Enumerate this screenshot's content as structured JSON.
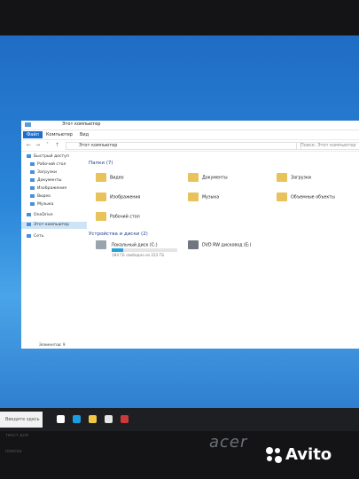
{
  "window": {
    "title": "Этот компьютер",
    "ribbon_tabs": [
      "Файл",
      "Компьютер",
      "Вид"
    ],
    "address": "Этот компьютер",
    "search_placeholder": "Поиск: Этот компьютер"
  },
  "sidebar": {
    "items": [
      {
        "label": "Быстрый доступ",
        "icon": "star-icon"
      },
      {
        "label": "Рабочий стол",
        "icon": "desktop-icon"
      },
      {
        "label": "Загрузки",
        "icon": "download-icon"
      },
      {
        "label": "Документы",
        "icon": "documents-icon"
      },
      {
        "label": "Изображения",
        "icon": "pictures-icon"
      },
      {
        "label": "Видео",
        "icon": "video-icon"
      },
      {
        "label": "Музыка",
        "icon": "music-icon"
      },
      {
        "label": "OneDrive",
        "icon": "cloud-icon"
      },
      {
        "label": "Этот компьютер",
        "icon": "computer-icon"
      },
      {
        "label": "Сеть",
        "icon": "network-icon"
      }
    ]
  },
  "folders": {
    "header": "Папки (7)",
    "items": [
      "Видео",
      "Документы",
      "Загрузки",
      "Изображения",
      "Музыка",
      "Объемные объекты",
      "Рабочий стол"
    ]
  },
  "devices": {
    "header": "Устройства и диски (2)",
    "drive_c": {
      "label": "Локальный диск (C:)",
      "free": "184 ГБ свободно из 222 ГБ",
      "used_fraction": 0.17
    },
    "drive_e": {
      "label": "DVD RW дисковод (E:)"
    }
  },
  "status": "Элементов: 9",
  "taskbar": {
    "search": "Введите здесь текст для поиска"
  },
  "brand": "acer",
  "watermark": "Avito",
  "colors": {
    "accent": "#1a6fd0",
    "folder": "#e8c25a",
    "desktop": "#2a86d9"
  }
}
